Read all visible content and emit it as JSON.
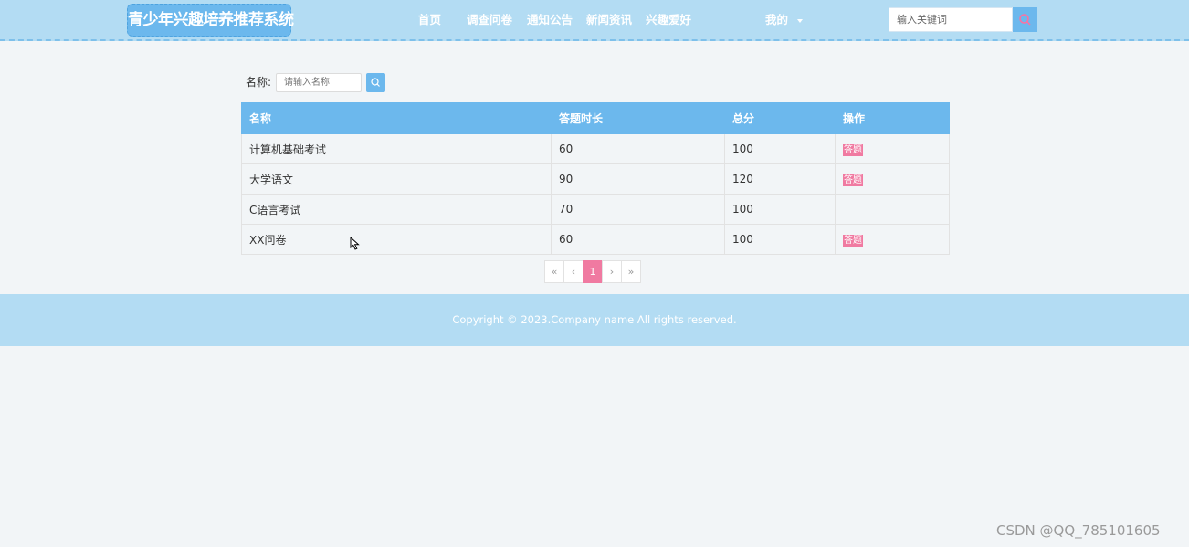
{
  "header": {
    "logo": "青少年兴趣培养推荐系统",
    "nav": [
      "首页",
      "调查问卷",
      "通知公告",
      "新闻资讯",
      "兴趣爱好"
    ],
    "user_menu": "我的",
    "search_placeholder": "输入关键词"
  },
  "filter": {
    "label": "名称:",
    "placeholder": "请输入名称"
  },
  "table": {
    "columns": [
      "名称",
      "答题时长",
      "总分",
      "操作"
    ],
    "rows": [
      {
        "name": "计算机基础考试",
        "duration": "60",
        "score": "100",
        "action": "答题"
      },
      {
        "name": "大学语文",
        "duration": "90",
        "score": "120",
        "action": "答题"
      },
      {
        "name": "C语言考试",
        "duration": "70",
        "score": "100",
        "action": ""
      },
      {
        "name": "XX问卷",
        "duration": "60",
        "score": "100",
        "action": "答题"
      }
    ]
  },
  "pagination": {
    "first": "«",
    "prev": "‹",
    "current": "1",
    "next": "›",
    "last": "»"
  },
  "footer": {
    "copyright": "Copyright © 2023.Company name All rights reserved."
  },
  "watermark": "CSDN @QQ_785101605",
  "colors": {
    "header_bg": "#b3dcf3",
    "primary": "#6cb8ed",
    "accent_pink": "#f07aa1",
    "page_bg": "#f2f5f7"
  },
  "icons": {
    "search": "search-icon",
    "dropdown": "caret-down-icon",
    "cursor": "mouse-cursor-icon"
  }
}
